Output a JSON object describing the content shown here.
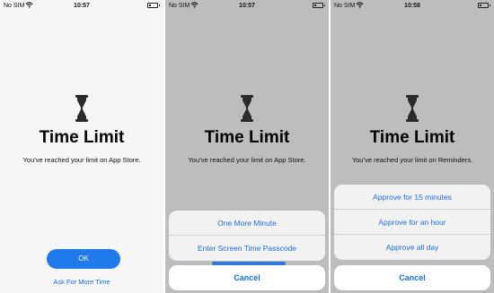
{
  "screens": [
    {
      "status": {
        "carrier": "No SIM",
        "time": "10:57"
      },
      "title": "Time Limit",
      "message": "You’ve reached your limit on App Store.",
      "ok_label": "OK",
      "more_time_label": "Ask For More Time"
    },
    {
      "status": {
        "carrier": "No SIM",
        "time": "10:57"
      },
      "title": "Time Limit",
      "message": "You’ve reached your limit on App Store.",
      "sheet": [
        "One More Minute",
        "Enter Screen Time Passcode"
      ],
      "cancel_label": "Cancel"
    },
    {
      "status": {
        "carrier": "No SIM",
        "time": "10:58"
      },
      "title": "Time Limit",
      "message": "You’ve reached your limit on Reminders.",
      "sheet": [
        "Approve for 15 minutes",
        "Approve for an hour",
        "Approve all day"
      ],
      "cancel_label": "Cancel"
    }
  ]
}
